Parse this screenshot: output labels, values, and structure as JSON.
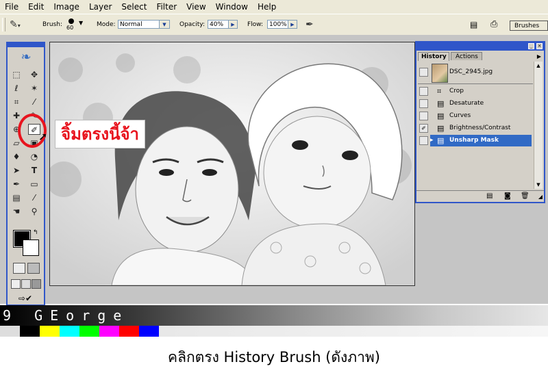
{
  "menu": [
    "File",
    "Edit",
    "Image",
    "Layer",
    "Select",
    "Filter",
    "View",
    "Window",
    "Help"
  ],
  "options": {
    "brush_label": "Brush:",
    "brush_size": "60",
    "mode_label": "Mode:",
    "mode_value": "Normal",
    "opacity_label": "Opacity:",
    "opacity_value": "40%",
    "flow_label": "Flow:",
    "flow_value": "100%",
    "brushes_tab": "Brushes"
  },
  "history": {
    "tab_active": "History",
    "tab_inactive": "Actions",
    "snapshot": "DSC_2945.jpg",
    "steps": [
      "Crop",
      "Desaturate",
      "Curves",
      "Brightness/Contrast",
      "Unsharp Mask"
    ]
  },
  "annotation": {
    "callout": "จิ้มตรงนี้จ้า"
  },
  "watermark": "9 GEorge",
  "swatches": [
    "#000000",
    "#ffff00",
    "#00ffff",
    "#00ff00",
    "#ff00ff",
    "#ff0000",
    "#0000ff"
  ],
  "caption": "คลิกตรง History Brush (ดังภาพ)",
  "colors": {
    "selection": "#316ac5",
    "panel_border": "#2f56c9",
    "annotation_red": "#e8141e"
  }
}
